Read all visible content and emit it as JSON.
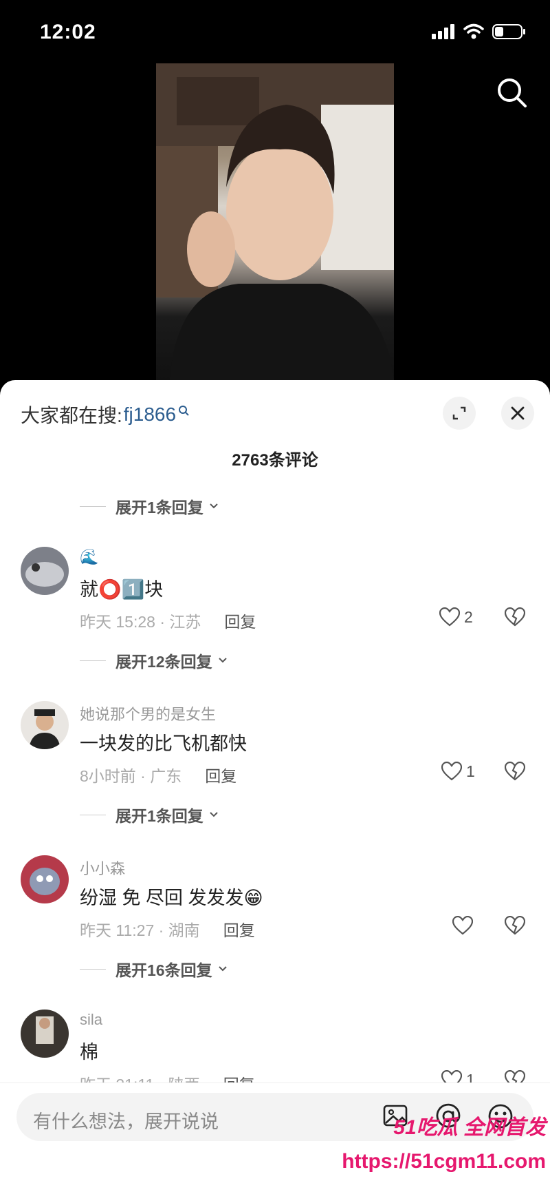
{
  "status_bar": {
    "time": "12:02"
  },
  "sheet": {
    "hot_search_label": "大家都在搜:",
    "hot_search_keyword": "fj1866",
    "comment_count": "2763条评论",
    "top_expand": "展开1条回复"
  },
  "comments": [
    {
      "username": "🌊",
      "text": "就⭕1️⃣块",
      "time": "昨天 15:28 · 江苏",
      "reply": "回复",
      "likes": "2",
      "expand": "展开12条回复"
    },
    {
      "username": "她说那个男的是女生",
      "text": "一块发的比飞机都快",
      "time": "8小时前 · 广东",
      "reply": "回复",
      "likes": "1",
      "expand": "展开1条回复"
    },
    {
      "username": "小小森",
      "text": "纷湿 免 尽回 发发发😁",
      "time": "昨天 11:27 · 湖南",
      "reply": "回复",
      "likes": "",
      "expand": "展开16条回复"
    },
    {
      "username": "sila",
      "text": "棉",
      "time": "昨天 21:11 · 陕西",
      "reply": "回复",
      "likes": "1"
    }
  ],
  "composer": {
    "placeholder": "有什么想法，展开说说"
  },
  "watermark": {
    "line1": "51吃瓜 全网首发",
    "line2": "https://51cgm11.com"
  },
  "icons": [
    "signal-icon",
    "wifi-icon",
    "battery-icon",
    "search-icon",
    "fullscreen-icon",
    "close-icon",
    "heart-icon",
    "broken-heart-icon",
    "image-icon",
    "at-icon",
    "emoji-icon"
  ]
}
